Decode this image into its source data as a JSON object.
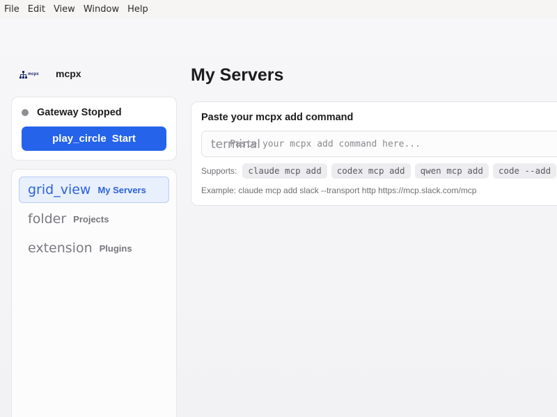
{
  "menubar": {
    "items": [
      "File",
      "Edit",
      "View",
      "Window",
      "Help"
    ]
  },
  "brand": {
    "logo_text": "mcpx",
    "name": "mcpx"
  },
  "gateway": {
    "status_label": "Gateway Stopped",
    "status_color": "#8e8e93",
    "start_icon": "play_circle",
    "start_label": "Start"
  },
  "nav": {
    "items": [
      {
        "icon": "grid_view",
        "label": "My Servers",
        "active": true
      },
      {
        "icon": "folder",
        "label": "Projects",
        "active": false
      },
      {
        "icon": "extension",
        "label": "Plugins",
        "active": false
      }
    ]
  },
  "main": {
    "title": "My Servers",
    "paste_card": {
      "title": "Paste your mcpx add command",
      "input_icon": "terminal",
      "input_placeholder": "Paste your mcpx add command here...",
      "input_value": "",
      "supports_label": "Supports:",
      "chips": [
        "claude mcp add",
        "codex mcp add",
        "qwen mcp add",
        "code --add"
      ],
      "example": "Example: claude mcp add slack --transport http https://mcp.slack.com/mcp"
    }
  },
  "colors": {
    "accent": "#2563eb",
    "active_nav_bg": "#e8effd",
    "active_nav_text": "#2b63d9"
  }
}
